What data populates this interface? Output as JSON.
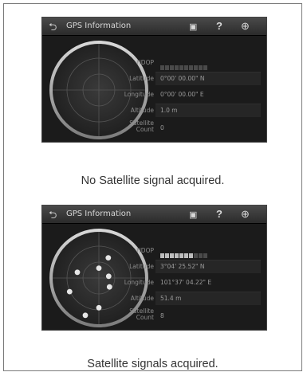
{
  "screens": [
    {
      "title": "GPS Information",
      "hdop_label": "HDOP",
      "hdop_filled": 0,
      "latitude_label": "Latitude",
      "latitude_value": "0°00' 00.00\" N",
      "longitude_label": "Longitude",
      "longitude_value": "0°00' 00.00\" E",
      "altitude_label": "Altitude",
      "altitude_value": "1.0 m",
      "count_label_1": "Satellite",
      "count_label_2": "Count",
      "count_value": "0",
      "satellites": []
    },
    {
      "title": "GPS Information",
      "hdop_label": "HDOP",
      "hdop_filled": 7,
      "latitude_label": "Latitude",
      "latitude_value": "3°04' 25.52\" N",
      "longitude_label": "Longitude",
      "longitude_value": "101°37' 04.22\" E",
      "altitude_label": "Altitude",
      "altitude_value": "51.4 m",
      "count_label_1": "Satellite",
      "count_label_2": "Count",
      "count_value": "8",
      "satellites": [
        {
          "az": 0,
          "el": 70
        },
        {
          "az": 25,
          "el": 45
        },
        {
          "az": 80,
          "el": 70
        },
        {
          "az": 130,
          "el": 62
        },
        {
          "az": 180,
          "el": 30
        },
        {
          "az": 200,
          "el": 10
        },
        {
          "az": 245,
          "el": 25
        },
        {
          "az": 285,
          "el": 45
        }
      ]
    }
  ],
  "captions": [
    "No Satellite signal acquired.",
    "Satellite signals acquired."
  ],
  "icons": {
    "back": "back-arrow-icon",
    "camera": "camera-icon",
    "help": "help-icon",
    "globe": "globe-icon"
  },
  "colors": {
    "hdop_on": "#bdbdbd",
    "hdop_off": "#4a4a4a",
    "satellite": "#e6e6e6"
  }
}
